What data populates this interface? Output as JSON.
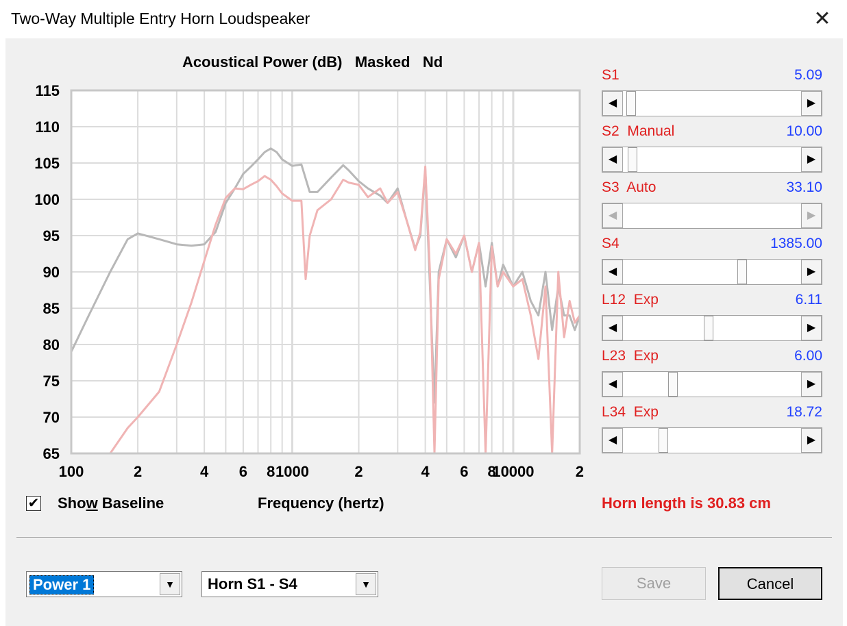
{
  "window": {
    "title": "Two-Way Multiple Entry Horn Loudspeaker",
    "close_label": "✕"
  },
  "chart_title": "Acoustical Power (dB)   Masked   Nd",
  "chart_data": {
    "type": "line",
    "title": "Acoustical Power (dB)   Masked   Nd",
    "xlabel": "Frequency (hertz)",
    "ylabel": "",
    "xscale": "log",
    "xlim": [
      100,
      20000
    ],
    "ylim": [
      65,
      115
    ],
    "grid": true,
    "y_ticks": [
      "115",
      "110",
      "105",
      "100",
      "95",
      "90",
      "85",
      "80",
      "75",
      "70",
      "65"
    ],
    "x_ticks": [
      "100",
      "2",
      "4",
      "6",
      "8",
      "1000",
      "2",
      "4",
      "6",
      "8",
      "10000",
      "2"
    ],
    "series": [
      {
        "color": "#b8b8b8",
        "x": [
          100,
          120,
          150,
          180,
          200,
          250,
          300,
          350,
          400,
          450,
          500,
          550,
          600,
          650,
          700,
          750,
          800,
          850,
          900,
          1000,
          1100,
          1200,
          1300,
          1500,
          1700,
          1800,
          2000,
          2200,
          2500,
          2700,
          3000,
          3300,
          3600,
          3800,
          4000,
          4200,
          4400,
          4600,
          5000,
          5500,
          6000,
          6500,
          7000,
          7500,
          8000,
          8500,
          9000,
          10000,
          11000,
          12000,
          13000,
          14000,
          15000,
          16000,
          17000,
          18000,
          19000,
          20000
        ],
        "y": [
          79,
          84,
          90,
          94.5,
          95.3,
          94.5,
          93.8,
          93.6,
          93.8,
          95.5,
          99.5,
          101.5,
          103.5,
          104.5,
          105.5,
          106.5,
          107,
          106.5,
          105.5,
          104.6,
          104.8,
          101,
          101,
          103,
          104.7,
          104,
          102.5,
          101.5,
          100.5,
          99.5,
          101.5,
          97,
          93.2,
          95,
          104.2,
          88,
          72,
          90,
          94.5,
          92,
          95,
          90,
          94,
          88,
          94,
          88,
          91,
          88,
          90,
          86,
          84,
          90,
          82,
          88,
          84,
          84,
          82,
          84
        ]
      },
      {
        "color": "#f0b4b4",
        "x": [
          150,
          180,
          200,
          250,
          300,
          350,
          400,
          450,
          500,
          550,
          600,
          650,
          700,
          750,
          800,
          850,
          900,
          1000,
          1100,
          1150,
          1200,
          1300,
          1500,
          1700,
          1800,
          2000,
          2200,
          2500,
          2700,
          3000,
          3300,
          3600,
          3800,
          4000,
          4200,
          4400,
          4600,
          5000,
          5500,
          6000,
          6500,
          7000,
          7500,
          8000,
          8500,
          9000,
          10000,
          11000,
          12000,
          13000,
          14000,
          15000,
          16000,
          17000,
          18000,
          19000,
          20000
        ],
        "y": [
          65,
          68.5,
          70,
          73.5,
          80,
          85.8,
          91.5,
          96.5,
          100.2,
          101.5,
          101.4,
          102,
          102.5,
          103.2,
          102.7,
          101.8,
          100.8,
          99.8,
          99.8,
          89,
          95,
          98.5,
          100,
          102.7,
          102.3,
          102,
          100.3,
          101.5,
          99.5,
          101,
          97,
          93,
          95.5,
          104.5,
          90,
          65,
          89,
          94.5,
          92.5,
          95,
          90,
          94,
          65,
          93.5,
          88,
          90,
          88,
          89,
          84,
          78,
          88,
          65,
          90,
          81,
          86,
          83,
          84
        ]
      }
    ]
  },
  "baseline_checkbox": {
    "label_pre": "Sho",
    "label_u": "w",
    "label_post": " Baseline",
    "checked": true,
    "mark": "✔"
  },
  "sliders": [
    {
      "label": "S1",
      "value": "5.09",
      "pos": 0.02,
      "enabled": true
    },
    {
      "label": "S2  Manual",
      "value": "10.00",
      "pos": 0.03,
      "enabled": true
    },
    {
      "label": "S3  Auto",
      "value": "33.10",
      "pos": 0.0,
      "enabled": false
    },
    {
      "label": "S4",
      "value": "1385.00",
      "pos": 0.68,
      "enabled": true
    },
    {
      "label": "L12  Exp",
      "value": "6.11",
      "pos": 0.48,
      "enabled": true
    },
    {
      "label": "L23  Exp",
      "value": "6.00",
      "pos": 0.27,
      "enabled": true
    },
    {
      "label": "L34  Exp",
      "value": "18.72",
      "pos": 0.21,
      "enabled": true
    }
  ],
  "horn_length": "Horn length is 30.83 cm",
  "combo_power": "Power 1",
  "combo_horn": "Horn S1 - S4",
  "buttons": {
    "save": "Save",
    "cancel": "Cancel"
  },
  "icons": {
    "left_arrow": "◀",
    "right_arrow": "▶",
    "dropdown_arrow": "▼"
  }
}
